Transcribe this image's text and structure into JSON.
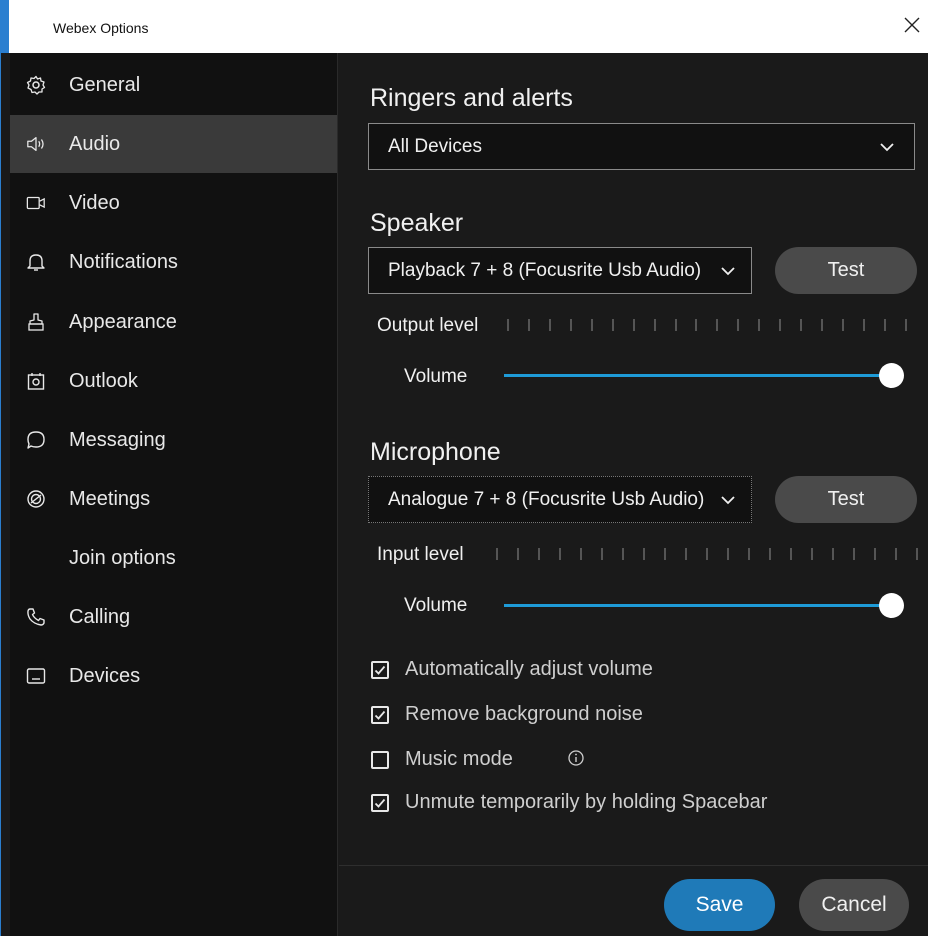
{
  "window": {
    "title": "Webex Options"
  },
  "sidebar": {
    "items": [
      {
        "label": "General",
        "icon": "gear-icon"
      },
      {
        "label": "Audio",
        "icon": "speaker-icon",
        "selected": true
      },
      {
        "label": "Video",
        "icon": "video-camera-icon"
      },
      {
        "label": "Notifications",
        "icon": "bell-icon"
      },
      {
        "label": "Appearance",
        "icon": "paint-brush-icon"
      },
      {
        "label": "Outlook",
        "icon": "outlook-icon"
      },
      {
        "label": "Messaging",
        "icon": "chat-bubble-icon"
      },
      {
        "label": "Meetings",
        "icon": "meetings-icon"
      },
      {
        "label": "Join options",
        "icon": ""
      },
      {
        "label": "Calling",
        "icon": "phone-icon"
      },
      {
        "label": "Devices",
        "icon": "device-icon"
      }
    ]
  },
  "ringers": {
    "title": "Ringers and alerts",
    "selected": "All Devices"
  },
  "speaker": {
    "title": "Speaker",
    "device": "Playback 7 + 8 (Focusrite Usb Audio)",
    "test_label": "Test",
    "level_label": "Output level",
    "volume_label": "Volume",
    "volume": 1.0
  },
  "microphone": {
    "title": "Microphone",
    "device": "Analogue 7 + 8 (Focusrite Usb Audio)",
    "test_label": "Test",
    "level_label": "Input level",
    "volume_label": "Volume",
    "volume": 1.0
  },
  "options": [
    {
      "label": "Automatically adjust volume",
      "checked": true
    },
    {
      "label": "Remove background noise",
      "checked": true
    },
    {
      "label": "Music mode",
      "checked": false
    },
    {
      "label": "Unmute temporarily by holding Spacebar",
      "checked": true
    }
  ],
  "footer": {
    "save_label": "Save",
    "cancel_label": "Cancel"
  },
  "colors": {
    "accent": "#1e9bd7",
    "save": "#1f7ab8",
    "selected": "#3a3a3a",
    "window_border": "#2b7fd0"
  }
}
